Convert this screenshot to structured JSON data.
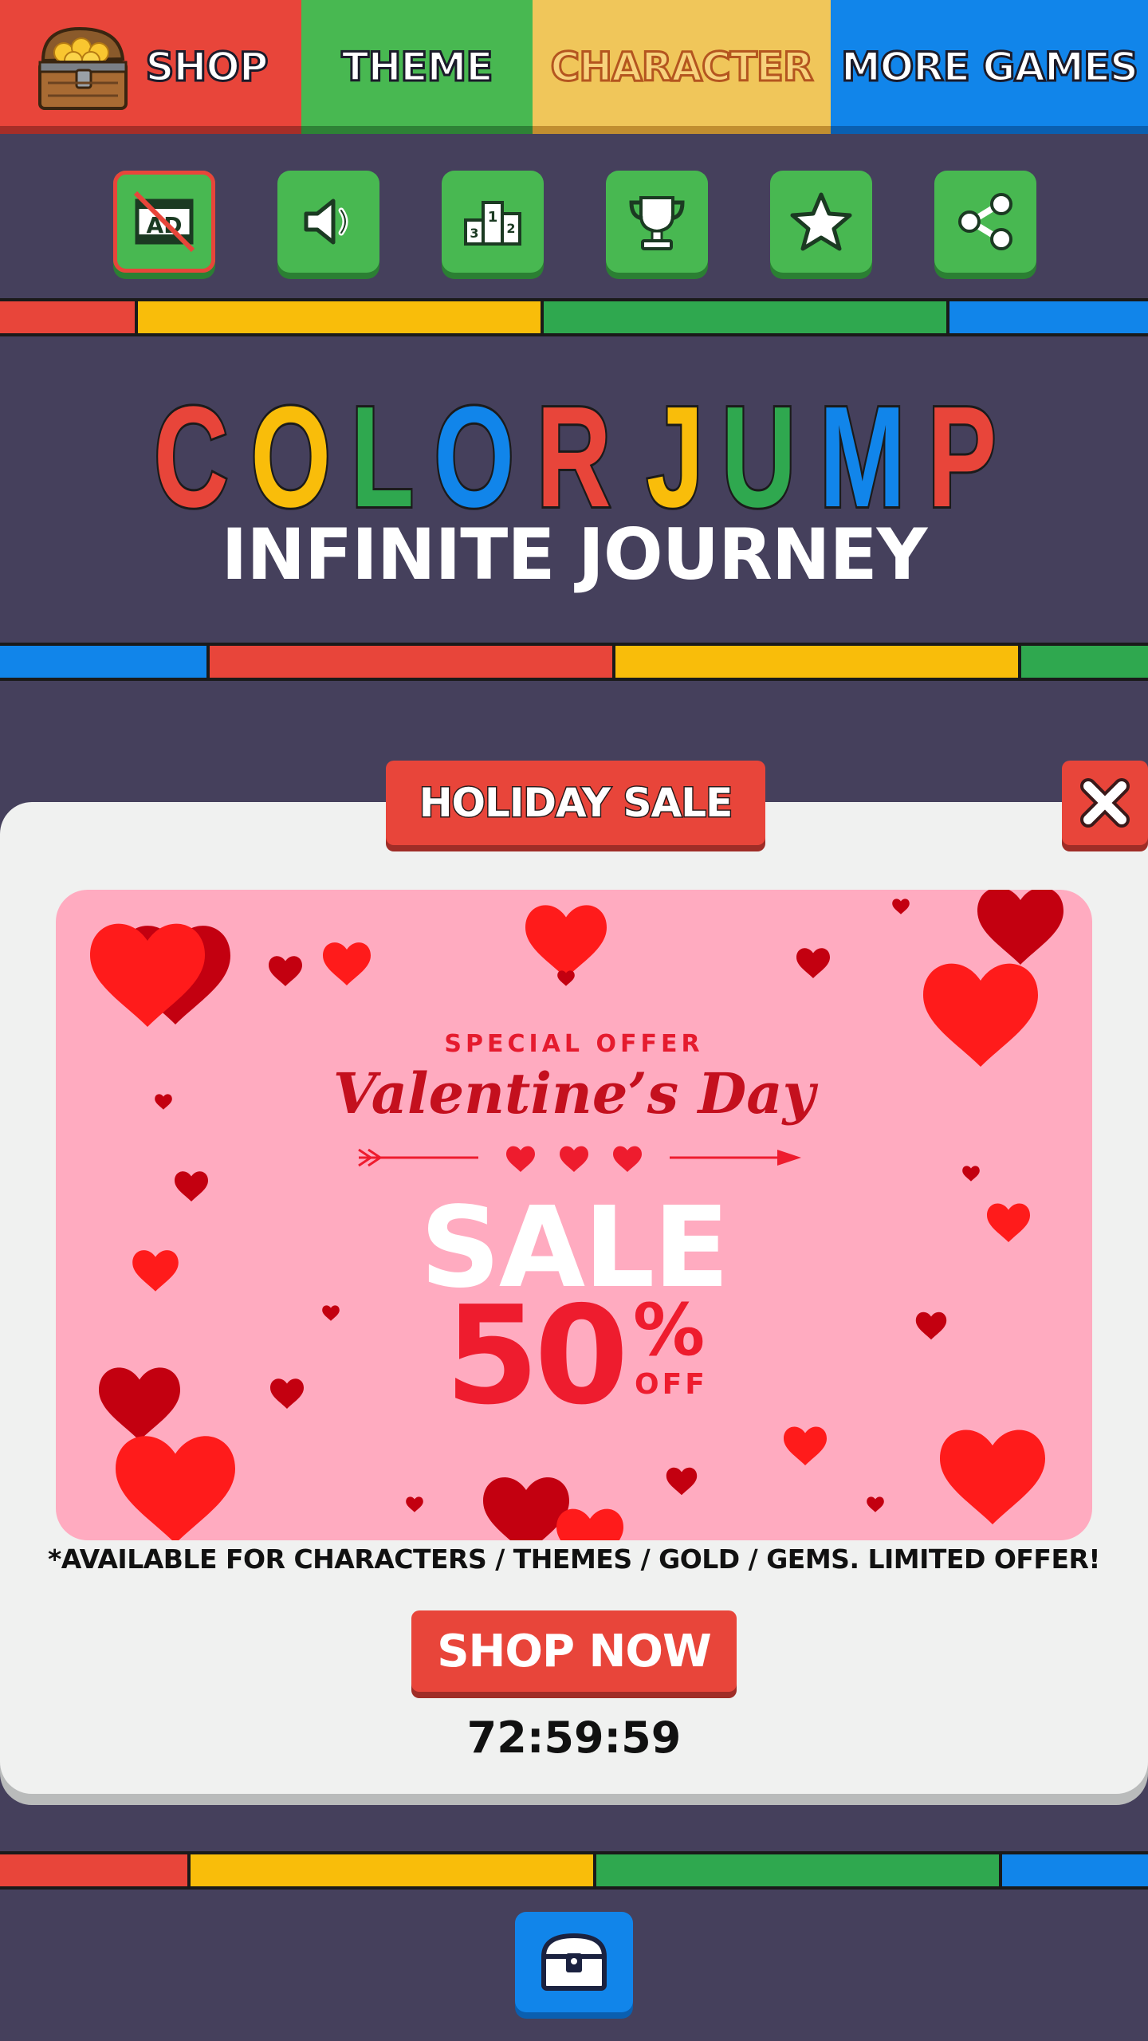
{
  "tabs": {
    "shop": "SHOP",
    "theme": "THEME",
    "character": "CHARACTER",
    "more_games": "MORE GAMES"
  },
  "toolbar": {
    "icons": [
      "no-ads-icon",
      "sound-icon",
      "leaderboard-icon",
      "trophy-icon",
      "star-icon",
      "share-icon"
    ],
    "no_ads_text": "AD",
    "podium_numbers": [
      "3",
      "1",
      "2"
    ]
  },
  "title": {
    "letters": [
      "C",
      "O",
      "L",
      "O",
      "R",
      " ",
      "J",
      "U",
      "M",
      "P"
    ],
    "letter_colors": [
      "#e8453a",
      "#f9bd0a",
      "#2fa84f",
      "#1185ea",
      "#e8453a",
      "",
      "#f9bd0a",
      "#2fa84f",
      "#1185ea",
      "#e8453a"
    ],
    "subtitle": "INFINITE JOURNEY"
  },
  "modal": {
    "header": "HOLIDAY SALE",
    "banner": {
      "special": "SPECIAL OFFER",
      "occasion": "Valentine’s Day",
      "sale": "SALE",
      "percent": "50",
      "percent_sign": "%",
      "off": "OFF"
    },
    "disclaimer": "*AVAILABLE FOR CHARACTERS / THEMES / GOLD / GEMS.  LIMITED OFFER!",
    "cta": "SHOP NOW",
    "timer": "72:59:59"
  },
  "colors": {
    "background": "#45405c",
    "red": "#e8453a",
    "yellow": "#f9bd0a",
    "green": "#2fa84f",
    "blue": "#1185ea"
  }
}
